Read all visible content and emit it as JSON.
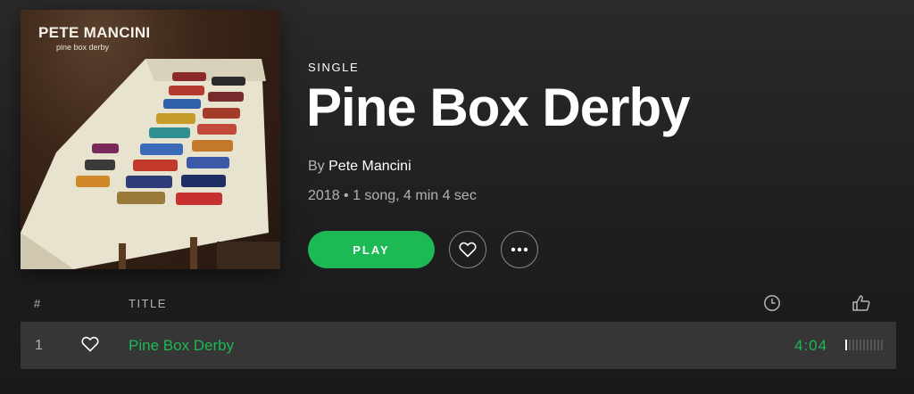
{
  "album": {
    "cover_art_text": "PETE MANCINI",
    "cover_art_subtext": "pine box derby",
    "type_label": "SINGLE",
    "title": "Pine Box Derby",
    "by_prefix": "By",
    "artist": "Pete Mancini",
    "meta": "2018 • 1 song, 4 min 4 sec"
  },
  "actions": {
    "play_label": "PLAY",
    "save_icon": "heart-outline-icon",
    "more_icon": "ellipsis-icon"
  },
  "tracklist": {
    "columns": {
      "number": "#",
      "title": "TITLE",
      "duration_icon": "clock-icon",
      "popularity_icon": "thumbs-up-icon"
    },
    "tracks": [
      {
        "number": "1",
        "title": "Pine Box Derby",
        "duration": "4:04",
        "popularity": 0.1
      }
    ]
  },
  "colors": {
    "accent": "#1db954",
    "background": "#1c1c1c",
    "row_highlight": "#363636",
    "secondary_text": "#b3b3b3"
  }
}
